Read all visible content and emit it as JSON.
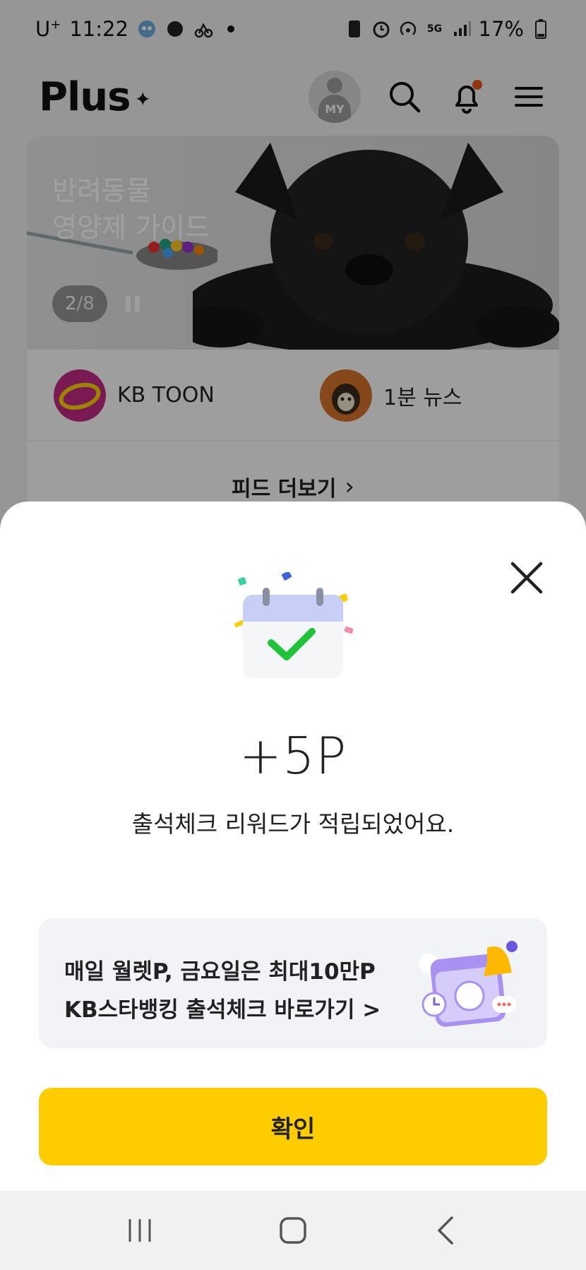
{
  "status_bar": {
    "carrier": "U",
    "carrier_sup": "+",
    "time": "11:22",
    "battery": "17%",
    "network": "5G"
  },
  "header": {
    "logo": "Plus",
    "logo_mark": "✦",
    "avatar_label": "MY"
  },
  "banner": {
    "title_line1": "반려동물",
    "title_line2": "영양제 가이드",
    "counter_current": "2",
    "counter_total": "/8"
  },
  "shortcuts": [
    {
      "label": "KB TOON",
      "thumb_text": "KB TOON"
    },
    {
      "label": "1분 뉴스"
    }
  ],
  "feed_more": {
    "label": "피드 더보기",
    "chevron": "›"
  },
  "sheet": {
    "reward": "+5P",
    "message": "출석체크 리워드가 적립되었어요.",
    "promo_line1": "매일 월렛P, 금요일은 최대10만P",
    "promo_line2": "KB스타뱅킹 출석체크 바로가기 >",
    "confirm": "확인"
  },
  "colors": {
    "accent_yellow": "#ffcc00",
    "check_green": "#20c33a",
    "calendar_top": "#c7cff7",
    "promo_bg": "#f1f3f7",
    "bell_badge": "#e8541c"
  },
  "icons": [
    "search-icon",
    "bell-icon",
    "menu-icon",
    "close-icon",
    "calendar-check-icon",
    "recent-apps-icon",
    "home-icon",
    "back-icon"
  ]
}
